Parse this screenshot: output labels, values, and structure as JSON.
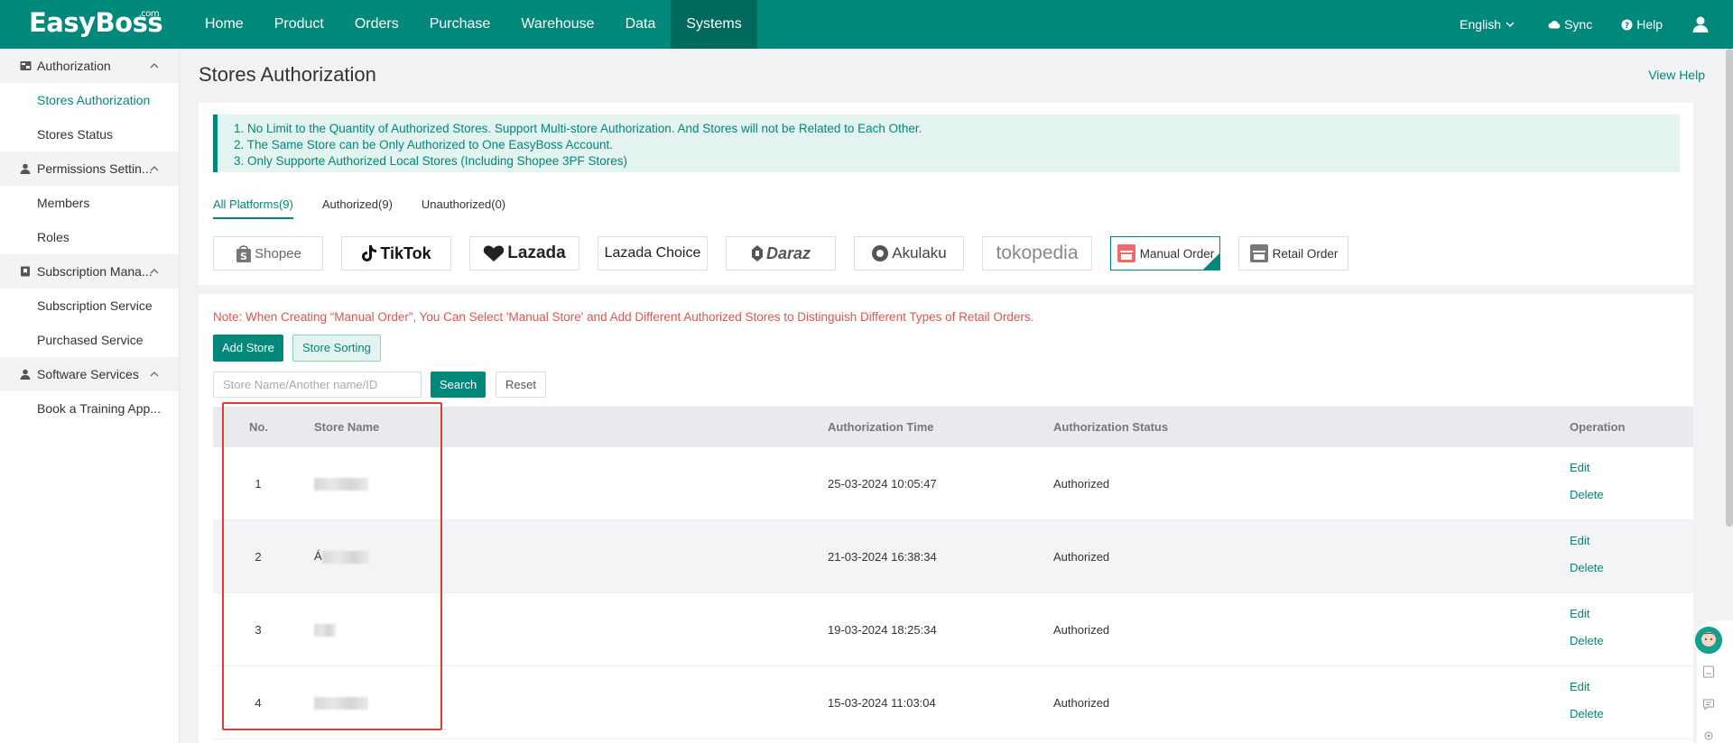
{
  "app": {
    "logo_text": "EasyBoss",
    "logo_suffix": ".com"
  },
  "nav": {
    "items": [
      {
        "label": "Home",
        "active": false
      },
      {
        "label": "Product",
        "active": false
      },
      {
        "label": "Orders",
        "active": false
      },
      {
        "label": "Purchase",
        "active": false
      },
      {
        "label": "Warehouse",
        "active": false
      },
      {
        "label": "Data",
        "active": false
      },
      {
        "label": "Systems",
        "active": true
      }
    ],
    "language": "English",
    "sync": "Sync",
    "help": "Help"
  },
  "sidebar": {
    "groups": [
      {
        "label": "Authorization",
        "icon": "id-card-icon",
        "items": [
          "Stores Authorization",
          "Stores Status"
        ]
      },
      {
        "label": "Permissions Settin...",
        "icon": "user-icon",
        "items": [
          "Members",
          "Roles"
        ]
      },
      {
        "label": "Subscription Mana...",
        "icon": "bookmark-icon",
        "items": [
          "Subscription Service",
          "Purchased Service"
        ]
      },
      {
        "label": "Software Services",
        "icon": "user-icon",
        "items": [
          "Book a Training App..."
        ]
      }
    ],
    "active_item": "Stores Authorization"
  },
  "page": {
    "title": "Stores Authorization",
    "view_help": "View Help"
  },
  "notice": {
    "lines": [
      "1. No Limit to the Quantity of Authorized Stores. Support Multi-store Authorization. And Stores will not be Related to Each Other.",
      "2. The Same Store can be Only Authorized to One EasyBoss Account.",
      "3. Only Supporte Authorized Local Stores (Including Shopee 3PF Stores)"
    ]
  },
  "tabs": [
    {
      "label": "All Platforms(9)",
      "active": true
    },
    {
      "label": "Authorized(9)",
      "active": false
    },
    {
      "label": "Unauthorized(0)",
      "active": false
    }
  ],
  "platforms": [
    {
      "label": "Shopee",
      "icon": "shopee-bag-icon",
      "active": false
    },
    {
      "label": "TikTok",
      "icon": "tiktok-note-icon",
      "active": false
    },
    {
      "label": "Lazada",
      "icon": "lazada-heart-icon",
      "active": false
    },
    {
      "label": "Lazada Choice",
      "icon": "",
      "active": false
    },
    {
      "label": "Daraz",
      "icon": "daraz-leaf-icon",
      "active": false
    },
    {
      "label": "Akulaku",
      "icon": "akulaku-circle-icon",
      "active": false
    },
    {
      "label": "tokopedia",
      "icon": "",
      "active": false
    },
    {
      "label": "Manual Order",
      "icon": "shop-icon",
      "active": true
    },
    {
      "label": "Retail Order",
      "icon": "store-icon",
      "active": false
    }
  ],
  "store_list": {
    "note": "Note: When Creating “Manual Order”, You Can Select 'Manual Store' and Add Different Authorized Stores to Distinguish Different Types of Retail Orders.",
    "add_store": "Add Store",
    "store_sorting": "Store Sorting",
    "search_placeholder": "Store Name/Another name/ID",
    "search": "Search",
    "reset": "Reset",
    "columns": [
      "No.",
      "Store Name",
      "Authorization Time",
      "Authorization Status",
      "Operation"
    ],
    "rows": [
      {
        "no": "1",
        "name": "",
        "time": "25-03-2024 10:05:47",
        "status": "Authorized",
        "edit": "Edit",
        "delete": "Delete"
      },
      {
        "no": "2",
        "name": "Á",
        "time": "21-03-2024 16:38:34",
        "status": "Authorized",
        "edit": "Edit",
        "delete": "Delete"
      },
      {
        "no": "3",
        "name": "",
        "time": "19-03-2024 18:25:34",
        "status": "Authorized",
        "edit": "Edit",
        "delete": "Delete"
      },
      {
        "no": "4",
        "name": "",
        "time": "15-03-2024 11:03:04",
        "status": "Authorized",
        "edit": "Edit",
        "delete": "Delete"
      }
    ]
  },
  "colors": {
    "brand": "#00887a",
    "brand_dark": "#00695e",
    "note_red": "#e45454",
    "highlight_red": "#e53935"
  }
}
